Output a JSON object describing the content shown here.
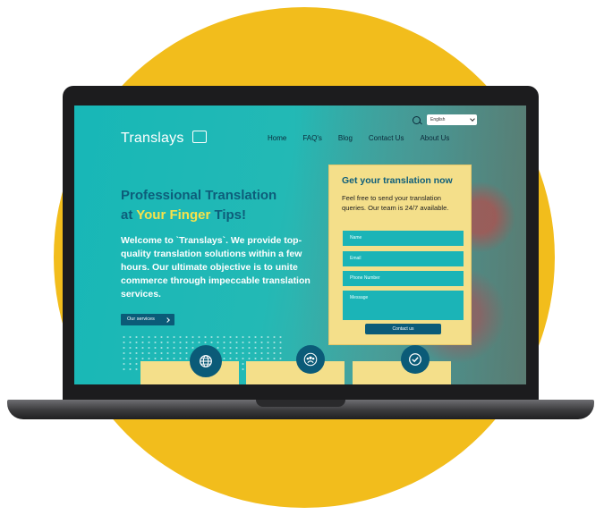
{
  "brand": {
    "name": "Translays"
  },
  "nav": {
    "items": [
      "Home",
      "FAQ's",
      "Blog",
      "Contact Us",
      "About Us"
    ]
  },
  "language": {
    "selected": "English"
  },
  "hero": {
    "title_line1": "Professional Translation",
    "title_line2_prefix": "at ",
    "title_line2_accent": "Your Finger",
    "title_line2_suffix": " Tips!",
    "text": "Welcome to `Translays`. We provide top-quality translation solutions within a few hours. Our ultimate objective is to unite commerce through impeccable translation services.",
    "services_button": "Our services"
  },
  "form": {
    "title": "Get your translation now",
    "description": "Feel free to send your translation queries. Our team is 24/7 available.",
    "fields": {
      "name": "Name",
      "email": "Email",
      "phone": "Phone Number",
      "message": "Message"
    },
    "submit": "Contact us"
  },
  "colors": {
    "accent": "#f2bd1c",
    "teal": "#1bb4b7",
    "navy": "#0b5b78",
    "highlight": "#f7e24a"
  },
  "icons": [
    "search-icon",
    "globe-icon",
    "team-icon",
    "check-badge-icon",
    "chat-bubble-logo-icon",
    "chevron-right-icon",
    "chevron-down-icon"
  ]
}
